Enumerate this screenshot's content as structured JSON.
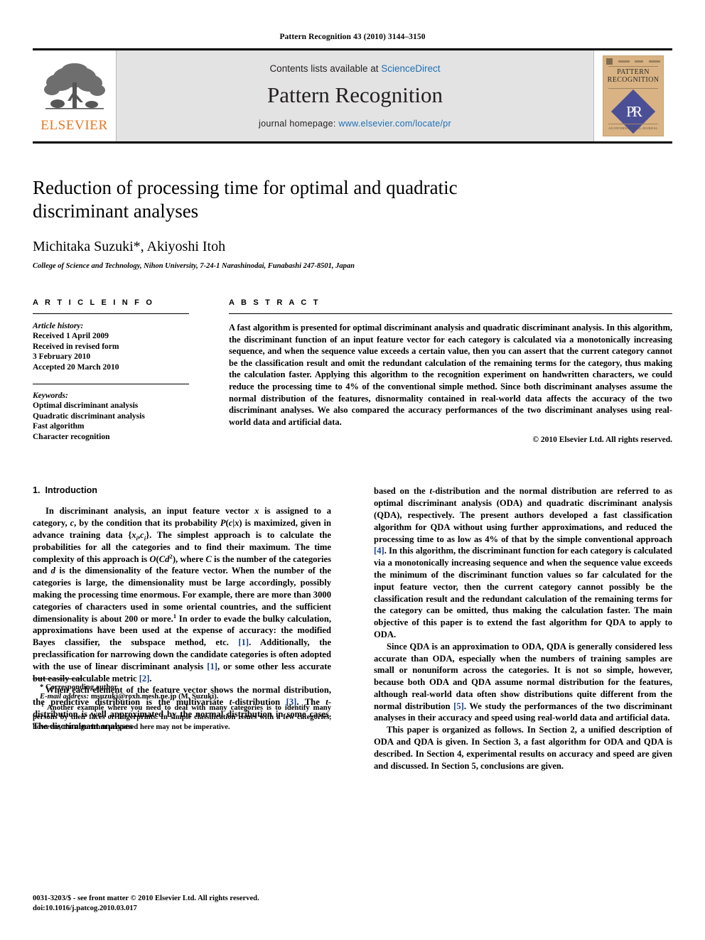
{
  "running_head": "Pattern Recognition 43 (2010) 3144–3150",
  "masthead": {
    "publisher_logo_text": "ELSEVIER",
    "contents_prefix": "Contents lists available at ",
    "contents_link": "ScienceDirect",
    "journal_title": "Pattern Recognition",
    "homepage_prefix": "journal homepage: ",
    "homepage_link": "www.elsevier.com/locate/pr",
    "cover": {
      "title_line1": "PATTERN",
      "title_line2": "RECOGNITION",
      "monogram": "PR",
      "footer_text": "AN INTERNATIONAL JOURNAL"
    }
  },
  "article": {
    "title": "Reduction of processing time for optimal and quadratic discriminant analyses",
    "authors": "Michitaka Suzuki*, Akiyoshi Itoh",
    "affiliation": "College of Science and Technology, Nihon University, 7-24-1 Narashinodai, Funabashi 247-8501, Japan"
  },
  "article_info": {
    "label": "A R T I C L E   I N F O",
    "history_label": "Article history:",
    "history": [
      "Received 1 April 2009",
      "Received in revised form",
      "3 February 2010",
      "Accepted 20 March 2010"
    ],
    "keywords_label": "Keywords:",
    "keywords": [
      "Optimal discriminant analysis",
      "Quadratic discriminant analysis",
      "Fast algorithm",
      "Character recognition"
    ]
  },
  "abstract": {
    "label": "A B S T R A C T",
    "text": "A fast algorithm is presented for optimal discriminant analysis and quadratic discriminant analysis. In this algorithm, the discriminant function of an input feature vector for each category is calculated via a monotonically increasing sequence, and when the sequence value exceeds a certain value, then you can assert that the current category cannot be the classification result and omit the redundant calculation of the remaining terms for the category, thus making the calculation faster. Applying this algorithm to the recognition experiment on handwritten characters, we could reduce the processing time to 4% of the conventional simple method. Since both discriminant analyses assume the normal distribution of the features, disnormality contained in real-world data affects the accuracy of the two discriminant analyses. We also compared the accuracy performances of the two discriminant analyses using real-world data and artificial data.",
    "copyright": "© 2010 Elsevier Ltd. All rights reserved."
  },
  "introduction": {
    "number": "1.",
    "heading": "Introduction"
  },
  "footnotes": {
    "corresponding": "* Corresponding author.",
    "email_label": "E-mail address:",
    "email": "msuzuki@roxh.mesh.ne.jp (M. Suzuki).",
    "note_marker": "1",
    "note_text": "Another example where you need to deal with many categories is to identify many persons by their faces or fingerprints. In simple classification issues with a few categories, however, the algorithm proposed here may not be imperative."
  },
  "page_footer": {
    "line1": "0031-3203/$ - see front matter © 2010 Elsevier Ltd. All rights reserved.",
    "line2": "doi:10.1016/j.patcog.2010.03.017"
  },
  "colors": {
    "link_blue": "#1c6fb5",
    "citation_blue": "#1a3e8c",
    "elsevier_orange": "#E87722",
    "masthead_gray": "#e3e3e3",
    "cover_tan": "#d9b384",
    "cover_diamond": "#4b4f96"
  }
}
